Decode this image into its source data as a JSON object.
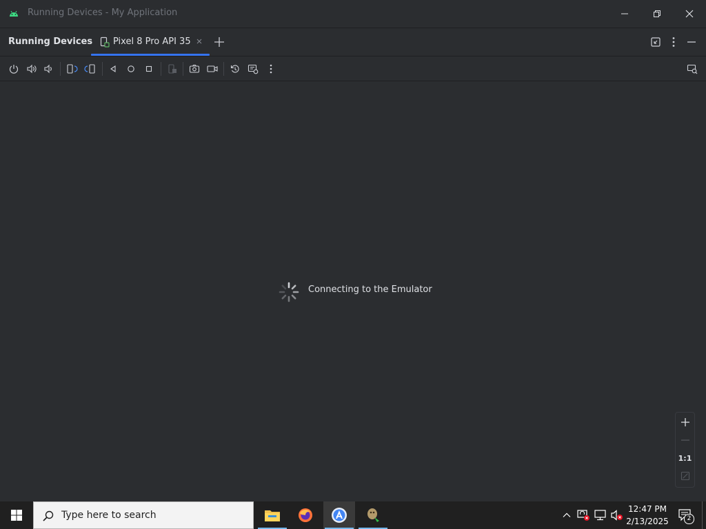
{
  "window": {
    "title": "Running Devices - My Application",
    "icon": "android-icon",
    "controls": [
      "minimize-icon",
      "restore-icon",
      "close-icon"
    ]
  },
  "tool_window": {
    "title": "Running Devices",
    "active_tab": {
      "label": "Pixel 8 Pro API 35",
      "icon": "device-icon"
    },
    "add_tab_icon": "plus-icon",
    "right_actions": [
      "restore-layout-icon",
      "more-vertical-icon",
      "hide-icon"
    ]
  },
  "toolbar": {
    "buttons": [
      "power-icon",
      "volume-up-icon",
      "volume-down-icon",
      "rotate-left-icon",
      "rotate-right-icon",
      "back-icon",
      "home-icon",
      "overview-icon",
      "snapshot-icon",
      "screenshot-icon",
      "screen-record-icon",
      "reset-icon",
      "extended-controls-icon",
      "more-vertical-icon",
      "device-mirroring-icon"
    ]
  },
  "main": {
    "status": "Connecting to the Emulator"
  },
  "zoom": {
    "zoom_in": "+",
    "zoom_out": "—",
    "actual_size": "1:1"
  },
  "taskbar": {
    "search_placeholder": "Type here to search",
    "apps": [
      "file-explorer-icon",
      "firefox-icon",
      "android-studio-icon",
      "app-icon"
    ],
    "tray": [
      "chevron-up-icon",
      "security-icon",
      "network-icon",
      "volume-muted-icon"
    ],
    "time": "12:47 PM",
    "date": "2/13/2025",
    "notification_count": "2"
  },
  "colors": {
    "background": "#2b2d30",
    "accent": "#3574f0",
    "taskbar": "#202020"
  }
}
